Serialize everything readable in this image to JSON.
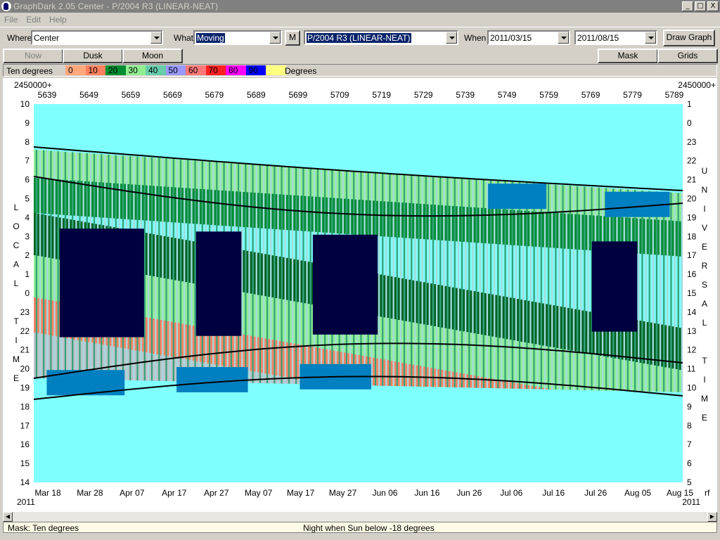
{
  "window": {
    "title": "GraphDark 2.05  Center  -  P/2004 R3 (LINEAR-NEAT)",
    "btn_min": "_",
    "btn_max": "□",
    "btn_close": "X"
  },
  "menu": [
    "File",
    "Edit",
    "Help"
  ],
  "toolbar": {
    "where_label": "Where",
    "where_value": "Center",
    "what_label": "What",
    "what_value": "Moving",
    "m_button": "M",
    "object_value": "P/2004 R3 (LINEAR-NEAT)",
    "when_label": "When",
    "date_start": "2011/03/15",
    "date_end": "2011/08/15",
    "draw_button": "Draw Graph"
  },
  "buttons": {
    "now": "Now",
    "dusk": "Dusk",
    "moon": "Moon",
    "mask": "Mask",
    "grids": "Grids"
  },
  "legend": {
    "left_label": "Ten degrees",
    "right_label": "Degrees",
    "items": [
      {
        "label": "0",
        "color": "#ffa87c"
      },
      {
        "label": "10",
        "color": "#ff8060"
      },
      {
        "label": "20",
        "color": "#008c30"
      },
      {
        "label": "30",
        "color": "#90ee90"
      },
      {
        "label": "40",
        "color": "#66ccaa"
      },
      {
        "label": "50",
        "color": "#9898ff"
      },
      {
        "label": "60",
        "color": "#ff7878"
      },
      {
        "label": "70",
        "color": "#ff2020"
      },
      {
        "label": "80",
        "color": "#ff00ff"
      },
      {
        "label": "90",
        "color": "#0000ff"
      },
      {
        "label": "",
        "color": "#ffff80"
      }
    ]
  },
  "chart_data": {
    "type": "heatmap",
    "top_axis_prefix": "2450000+",
    "top_ticks": [
      "5639",
      "5649",
      "5659",
      "5669",
      "5679",
      "5689",
      "5699",
      "5709",
      "5719",
      "5729",
      "5739",
      "5749",
      "5759",
      "5769",
      "5779",
      "5789"
    ],
    "left_ticks": [
      "10",
      "9",
      "8",
      "7",
      "6",
      "5",
      "4",
      "3",
      "2",
      "1",
      "0",
      "23",
      "22",
      "21",
      "20",
      "19",
      "18",
      "17",
      "16",
      "15",
      "14"
    ],
    "right_ticks": [
      "1",
      "0",
      "23",
      "22",
      "21",
      "20",
      "19",
      "18",
      "17",
      "16",
      "15",
      "14",
      "13",
      "12",
      "11",
      "10",
      "9",
      "8",
      "7",
      "6",
      "5"
    ],
    "left_axis_title": [
      "L",
      "O",
      "C",
      "A",
      "L",
      "",
      "T",
      "I",
      "M",
      "E"
    ],
    "right_axis_title": [
      "U",
      "N",
      "I",
      "V",
      "E",
      "R",
      "S",
      "A",
      "L",
      "",
      "T",
      "I",
      "M",
      "E"
    ],
    "bottom_ticks": [
      "Mar 18",
      "Mar 28",
      "Apr 07",
      "Apr 17",
      "Apr 27",
      "May 07",
      "May 17",
      "May 27",
      "Jun 06",
      "Jun 16",
      "Jun 26",
      "Jul 06",
      "Jul 16",
      "Jul 26",
      "Aug 05",
      "Aug 15"
    ],
    "year_left": "2011",
    "year_right": "2011",
    "corner_label": "rf",
    "colors": {
      "background": "#80ffff",
      "twilight": "#0080c0",
      "dark": "#000040",
      "gray": "#c0c0c8",
      "green_dark": "#006020",
      "green": "#008c30",
      "green_light": "#90ee90",
      "salmon": "#ff8060"
    }
  },
  "scroll": {
    "left": "◀",
    "right": "▶"
  },
  "status": {
    "mask": "Mask:  Ten degrees",
    "night": "Night when Sun below -18 degrees"
  }
}
